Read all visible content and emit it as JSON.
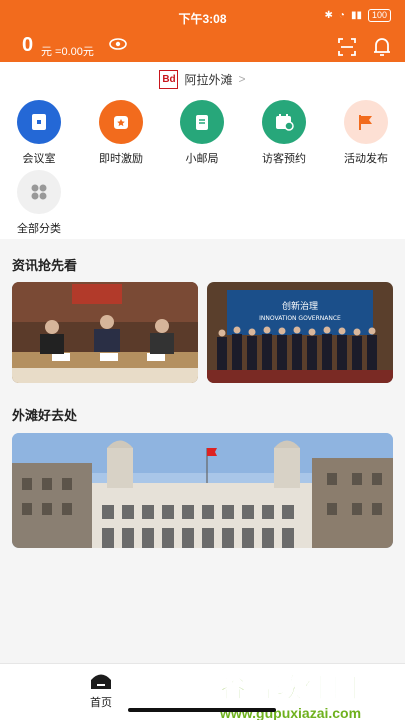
{
  "status": {
    "time": "下午3:08",
    "battery": "100"
  },
  "header": {
    "points": "0",
    "money": "元 =0.00元"
  },
  "brand": {
    "name": "阿拉外滩",
    "logo_text": "Bd"
  },
  "services": [
    {
      "label": "会议室",
      "color": "#2468d6"
    },
    {
      "label": "即时激励",
      "color": "#f26b1d"
    },
    {
      "label": "小邮局",
      "color": "#27a77a"
    },
    {
      "label": "访客预约",
      "color": "#27a77a"
    },
    {
      "label": "活动发布",
      "color": "#fde0d4"
    },
    {
      "label": "全部分类",
      "color": "#f0f0f0"
    }
  ],
  "sections": {
    "news": "资讯抢先看",
    "spots": "外滩好去处"
  },
  "news_banner": {
    "title": "创新治理",
    "subtitle": "INNOVATION GOVERNANCE"
  },
  "tabbar": {
    "home": "首页"
  },
  "watermark": {
    "title": "谷普软件园",
    "url": "www.gupuxiazai.com"
  }
}
